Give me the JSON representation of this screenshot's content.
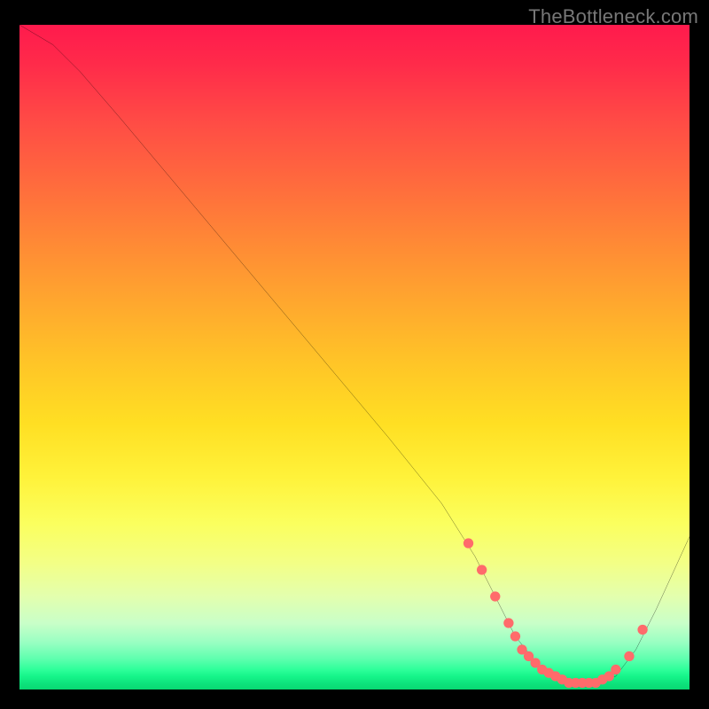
{
  "watermark": "TheBottleneck.com",
  "chart_data": {
    "type": "line",
    "title": "",
    "xlabel": "",
    "ylabel": "",
    "xlim": [
      0,
      100
    ],
    "ylim": [
      0,
      100
    ],
    "grid": false,
    "legend": false,
    "background_gradient": {
      "top_color": "#ff1a4d",
      "mid_color": "#ffe030",
      "bottom_color": "#08d872",
      "description": "red-to-yellow-to-green vertical gradient indicating bottleneck severity (red=high, green=low)"
    },
    "series": [
      {
        "name": "bottleneck-curve",
        "type": "line",
        "color": "#000000",
        "x": [
          0,
          5,
          9,
          15,
          25,
          35,
          45,
          55,
          63,
          68,
          71,
          74,
          78,
          82,
          86,
          89,
          92,
          95,
          100
        ],
        "values": [
          100,
          97,
          93,
          86,
          74,
          62,
          50,
          38,
          28,
          20,
          14,
          8,
          3,
          1,
          1,
          2,
          6,
          12,
          23
        ]
      },
      {
        "name": "highlight-points",
        "type": "scatter",
        "color": "#ff6b6b",
        "x": [
          67,
          69,
          71,
          73,
          74,
          75,
          76,
          77,
          78,
          79,
          80,
          81,
          82,
          83,
          84,
          85,
          86,
          87,
          88,
          89,
          91,
          93
        ],
        "values": [
          22,
          18,
          14,
          10,
          8,
          6,
          5,
          4,
          3,
          2.5,
          2,
          1.5,
          1,
          1,
          1,
          1,
          1,
          1.5,
          2,
          3,
          5,
          9
        ]
      }
    ],
    "annotations": []
  }
}
